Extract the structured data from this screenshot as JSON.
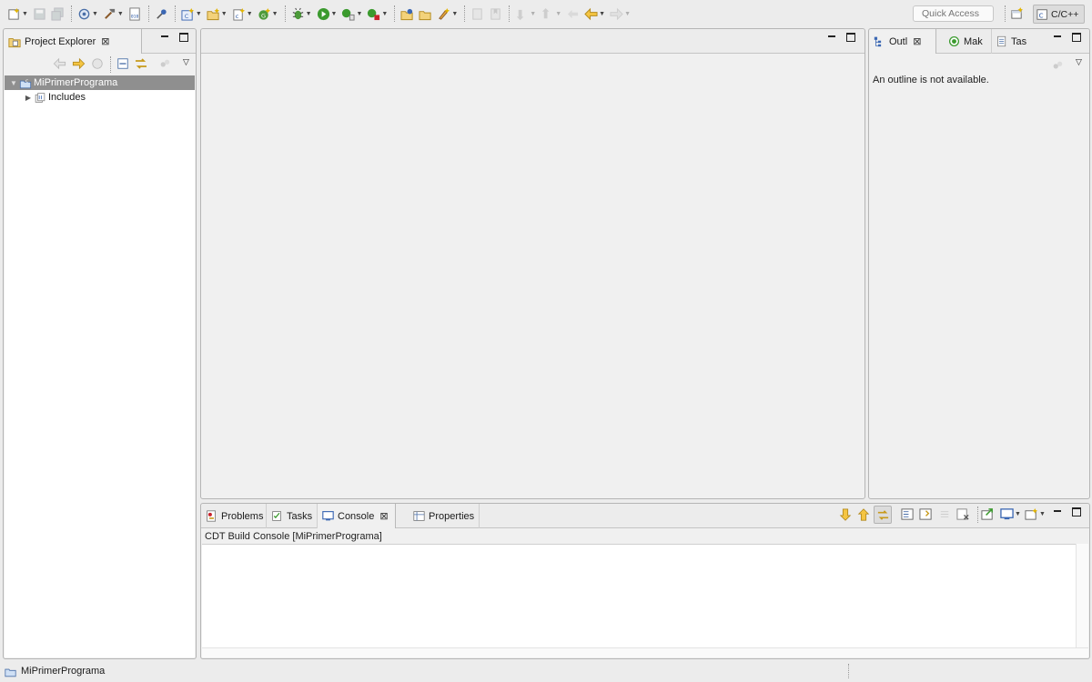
{
  "toolbar": {
    "icons": [
      "new-icon",
      "save-icon",
      "save-all-icon",
      "build-config-icon",
      "build-hammer-icon",
      "binary-icon",
      "pin-icon",
      "new-class-icon",
      "new-folder-icon",
      "new-source-icon",
      "new-type-icon",
      "debug-bug-icon",
      "run-icon",
      "coverage-icon",
      "external-tools-icon",
      "open-type-icon",
      "open-element-icon",
      "search-icon",
      "annotation-icon",
      "bookmark-icon",
      "next-annotation-icon",
      "prev-annotation-icon",
      "last-edit-icon",
      "back-icon",
      "forward-icon"
    ],
    "quick_access_placeholder": "Quick Access",
    "perspective_label": "C/C++"
  },
  "project_explorer": {
    "tab_label": "Project Explorer",
    "tree": [
      {
        "label": "MiPrimerPrograma",
        "expanded": true,
        "selected": true
      },
      {
        "label": "Includes",
        "expanded": false,
        "selected": false
      }
    ]
  },
  "outline": {
    "tabs": [
      {
        "label": "Outl",
        "icon": "outline-icon",
        "active": true
      },
      {
        "label": "Mak",
        "icon": "make-target-icon",
        "active": false
      },
      {
        "label": "Tas",
        "icon": "task-list-icon",
        "active": false
      }
    ],
    "message": "An outline is not available."
  },
  "console": {
    "tabs": [
      {
        "label": "Problems",
        "icon": "problems-icon",
        "active": false
      },
      {
        "label": "Tasks",
        "icon": "tasks-icon",
        "active": false
      },
      {
        "label": "Console",
        "icon": "console-icon",
        "active": true
      },
      {
        "label": "Properties",
        "icon": "properties-icon",
        "active": false
      }
    ],
    "title": "CDT Build Console [MiPrimerPrograma]"
  },
  "statusbar": {
    "project": "MiPrimerPrograma"
  },
  "colors": {
    "selection": "#8f8f8f",
    "background": "#ececec",
    "panel_border": "#b5b5b5"
  }
}
